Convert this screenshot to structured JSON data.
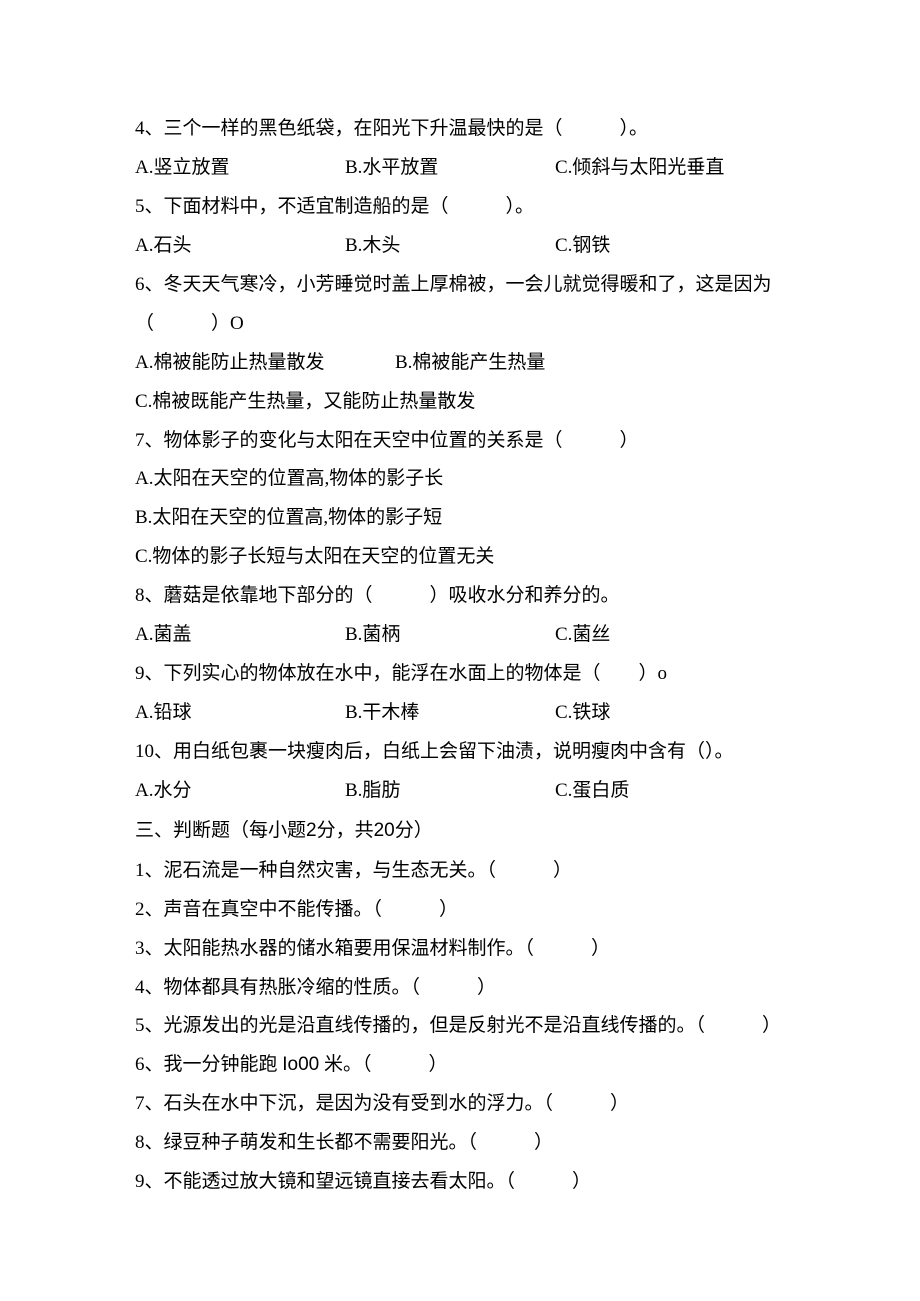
{
  "q4": {
    "text": "4、三个一样的黑色纸袋，在阳光下升温最快的是（　　　）。",
    "A": "A.竖立放置",
    "B": "B.水平放置",
    "C": "C.倾斜与太阳光垂直"
  },
  "q5": {
    "text": "5、下面材料中，不适宜制造船的是（　　　）。",
    "A": "A.石头",
    "B": "B.木头",
    "C": "C.钢铁"
  },
  "q6": {
    "text1": "6、冬天天气寒冷，小芳睡觉时盖上厚棉被，一会儿就觉得暖和了，这是因为",
    "text2": "（　　　）O",
    "A": "A.棉被能防止热量散发",
    "B": "B.棉被能产生热量",
    "C2": "C.棉被既能产生热量，又能防止热量散发"
  },
  "q7": {
    "text": "7、物体影子的变化与太阳在天空中位置的关系是（　　　）",
    "A": "A.太阳在天空的位置高,物体的影子长",
    "B": "B.太阳在天空的位置高,物体的影子短",
    "C": "C.物体的影子长短与太阳在天空的位置无关"
  },
  "q8": {
    "text": "8、蘑菇是依靠地下部分的（　　　）吸收水分和养分的。",
    "A": "A.菌盖",
    "B": "B.菌柄",
    "C": "C.菌丝"
  },
  "q9": {
    "text": "9、下列实心的物体放在水中，能浮在水面上的物体是（　　）o",
    "A": "A.铅球",
    "B": "B.干木棒",
    "C": "C.铁球"
  },
  "q10": {
    "text": "10、用白纸包裹一块瘦肉后，白纸上会留下油渍，说明瘦肉中含有（）。",
    "A": "A.水分",
    "B": "B.脂肪",
    "C": "C.蛋白质"
  },
  "section3": {
    "prefix": "三、判断题（每小题",
    "two": "2",
    "mid": "分，共",
    "twenty": "20",
    "suffix": "分）"
  },
  "j1": "1、泥石流是一种自然灾害，与生态无关。（　　　）",
  "j2": "2、声音在真空中不能传播。（　　　）",
  "j3": "3、太阳能热水器的储水箱要用保温材料制作。（　　　）",
  "j4": "4、物体都具有热胀冷缩的性质。（　　　）",
  "j5": "5、光源发出的光是沿直线传播的，但是反射光不是沿直线传播的。（　　　）",
  "j6_a": "6、我一分钟能跑",
  "j6_b": "Io00",
  "j6_c": "米。（　　　）",
  "j7": "7、石头在水中下沉，是因为没有受到水的浮力。（　　　）",
  "j8": "8、绿豆种子萌发和生长都不需要阳光。（　　　）",
  "j9": "9、不能透过放大镜和望远镜直接去看太阳。（　　　）"
}
